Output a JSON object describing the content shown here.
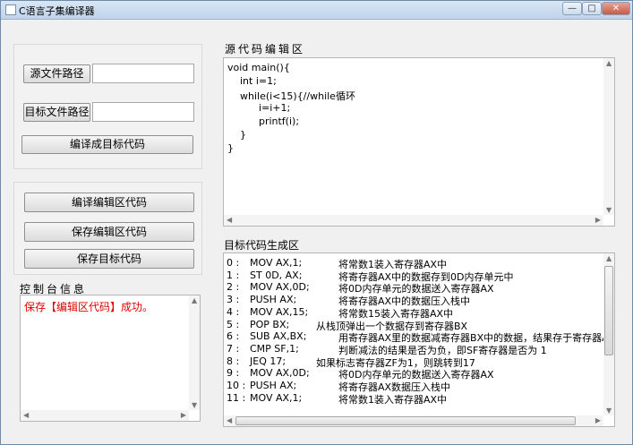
{
  "window": {
    "title": "C语言子集编译器",
    "controls": {
      "minimize": "—",
      "maximize": "□",
      "close": "✕"
    }
  },
  "left_panel": {
    "source_path_button": "源文件路径",
    "source_path_value": "",
    "target_path_button": "目标文件路径",
    "target_path_value": "",
    "compile_to_target_button": "编译成目标代码",
    "compile_editor_button": "编译编辑区代码",
    "save_editor_button": "保存编辑区代码",
    "save_target_button": "保存目标代码",
    "console_title": "控制台信息",
    "console_message": "保存【编辑区代码】成功。"
  },
  "source_editor": {
    "title": "源代码编辑区",
    "lines": [
      "void main(){",
      "    int i=1;",
      "    while(i<15){//while循环",
      "          i=i+1;",
      "          printf(i);",
      "    }",
      "}"
    ]
  },
  "target_area": {
    "title": "目标代码生成区",
    "rows": [
      {
        "num": "0 :",
        "instr": "MOV AX,1;",
        "comment": "将常数1装入寄存器AX中",
        "shift": false
      },
      {
        "num": "1 :",
        "instr": "ST 0D, AX;",
        "comment": "将寄存器AX中的数据存到0D内存单元中",
        "shift": false
      },
      {
        "num": "2 :",
        "instr": "MOV AX,0D;",
        "comment": "将0D内存单元的数据送入寄存器AX",
        "shift": false
      },
      {
        "num": "3 :",
        "instr": "PUSH AX;",
        "comment": "将寄存器AX中的数据压入栈中",
        "shift": false
      },
      {
        "num": "4 :",
        "instr": "MOV AX,15;",
        "comment": "将常数15装入寄存器AX中",
        "shift": false
      },
      {
        "num": "5 :",
        "instr": "POP BX;",
        "comment": "从栈顶弹出一个数据存到寄存器BX",
        "shift": true
      },
      {
        "num": "6 :",
        "instr": "SUB AX,BX;",
        "comment": "用寄存器AX里的数据减寄存器BX中的数据，结果存于寄存器A)",
        "shift": false
      },
      {
        "num": "7 :",
        "instr": "CMP SF,1;",
        "comment": "判断减法的结果是否为负，即SF寄存器是否为 1",
        "shift": false
      },
      {
        "num": "8 :",
        "instr": "JEQ 17;",
        "comment": "如果标志寄存器ZF为1，则跳转到17",
        "shift": true
      },
      {
        "num": "9 :",
        "instr": "MOV AX,0D;",
        "comment": "将0D内存单元的数据送入寄存器AX",
        "shift": false
      },
      {
        "num": "10 :",
        "instr": "PUSH AX;",
        "comment": "将寄存器AX数据压入栈中",
        "shift": false
      },
      {
        "num": "11 :",
        "instr": "MOV AX,1;",
        "comment": "将常数1装入寄存器AX中",
        "shift": false
      }
    ]
  }
}
